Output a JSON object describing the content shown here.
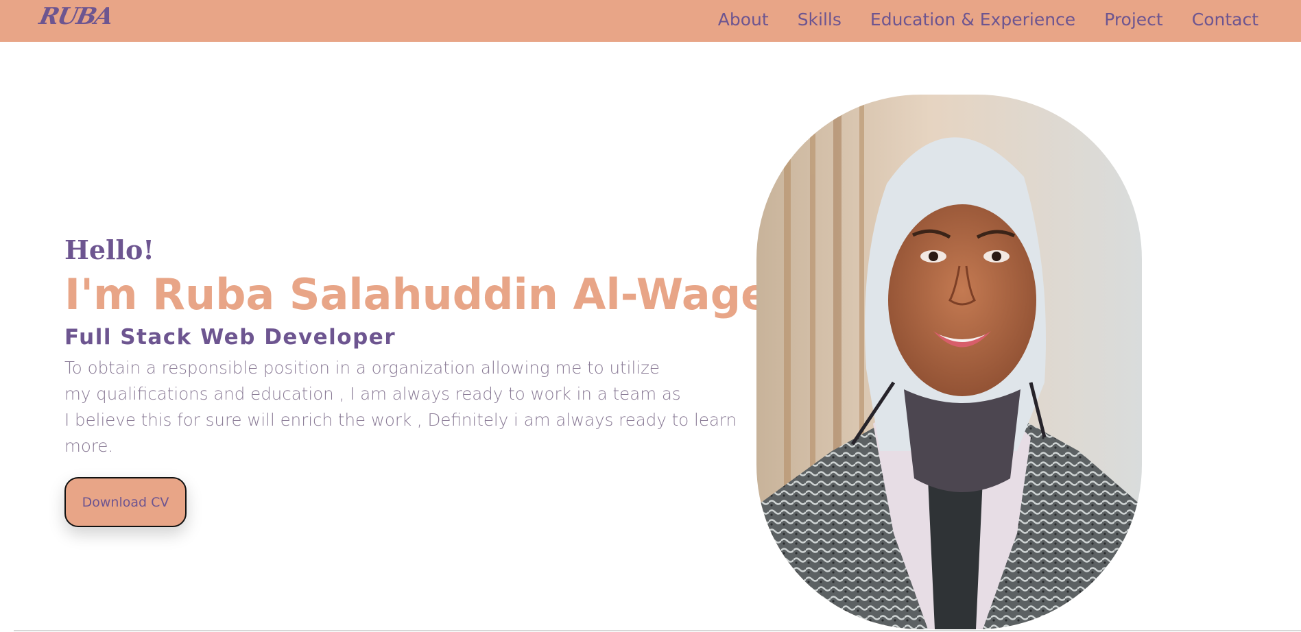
{
  "brand": {
    "logo_text": "RUBA",
    "accent": "#e8a587",
    "secondary": "#6d5590"
  },
  "nav": {
    "items": [
      {
        "label": "About"
      },
      {
        "label": "Skills"
      },
      {
        "label": "Education & Experience"
      },
      {
        "label": "Project"
      },
      {
        "label": "Contact"
      }
    ]
  },
  "hero": {
    "greeting": "Hello!",
    "name": "I'm Ruba Salahuddin Al-Wageei",
    "role": "Full Stack Web Developer",
    "objective_lines": [
      "To obtain a responsible position in a organization allowing me to utilize",
      "my qualifications and education , I am always ready to work in a team as",
      "I believe this for sure will enrich the work , Definitely i am always ready to learn",
      "more."
    ],
    "cta_label": "Download CV"
  },
  "portrait": {
    "icon": "profile-photo"
  }
}
